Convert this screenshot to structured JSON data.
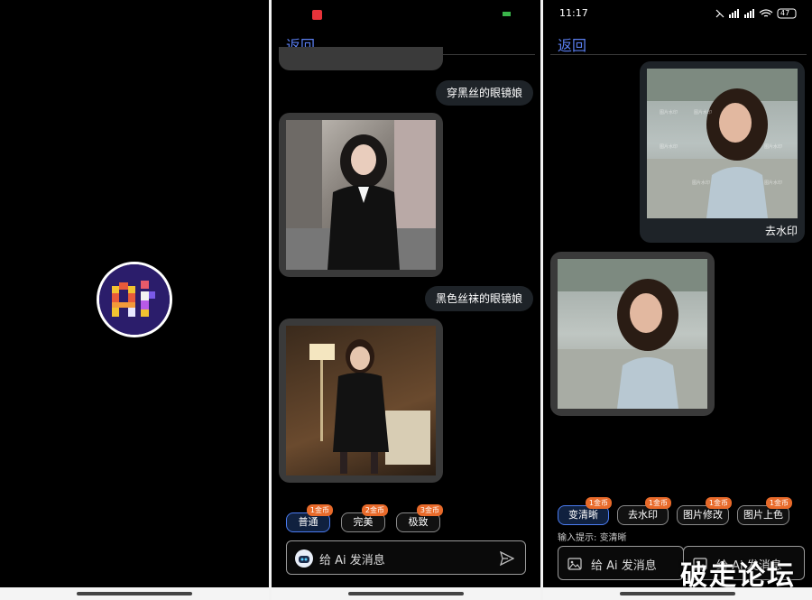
{
  "colors": {
    "accent": "#5a7ef0",
    "badge": "#e86a2a",
    "bubble": "#1e2328"
  },
  "screen2": {
    "back_label": "返回",
    "messages": [
      "穿黑丝的眼镜娘",
      "黑色丝袜的眼镜娘"
    ],
    "quality_chips": [
      {
        "label": "普通",
        "badge": "1金币"
      },
      {
        "label": "完美",
        "badge": "2金币"
      },
      {
        "label": "极致",
        "badge": "3金币"
      }
    ],
    "input_placeholder": "给 Ai 发消息"
  },
  "screen3": {
    "time": "11:17",
    "battery": "47",
    "back_label": "返回",
    "user_caption": "去水印",
    "tool_chips": [
      {
        "label": "变清晰",
        "badge": "1金币"
      },
      {
        "label": "去水印",
        "badge": "1金币"
      },
      {
        "label": "图片修改",
        "badge": "1金币"
      },
      {
        "label": "图片上色",
        "badge": "1金币"
      }
    ],
    "hint_label": "输入提示:",
    "hint_value": "变清晰",
    "input_placeholder": "给 Ai 发消息",
    "watermark": "破走论坛"
  }
}
